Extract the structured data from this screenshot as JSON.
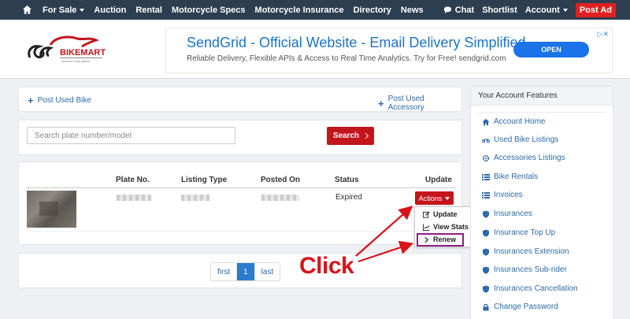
{
  "topnav": {
    "items": [
      "For Sale",
      "Auction",
      "Rental",
      "Motorcycle Specs",
      "Motorcycle Insurance",
      "Directory",
      "News"
    ],
    "right": {
      "chat": "Chat",
      "shortlist": "Shortlist",
      "account": "Account",
      "post_ad": "Post Ad"
    },
    "bg_color": "#2d3e50",
    "accent_color": "#e02020"
  },
  "logo": {
    "text": "BIKEMART",
    "tagline": "WE BUILD YOUR DREAM"
  },
  "ad": {
    "title": "SendGrid - Official Website - Email Delivery Simplified",
    "description": "Reliable Delivery, Flexible APIs & Access to Real Time Analytics. Try for Free! sendgrid.com",
    "button": "OPEN"
  },
  "actions_bar": {
    "post_used_bike": "Post Used Bike",
    "post_used_accessory": "Post Used Accessory"
  },
  "search": {
    "placeholder": "Search plate number/model",
    "button": "Search"
  },
  "table": {
    "headers": {
      "plate": "Plate No.",
      "type": "Listing Type",
      "posted": "Posted On",
      "status": "Status",
      "update": "Update"
    },
    "rows": [
      {
        "status": "Expired",
        "actions": "Actions"
      }
    ]
  },
  "dropdown": {
    "items": [
      "Update",
      "View Stats",
      "Renew"
    ]
  },
  "pagination": {
    "first": "first",
    "current": "1",
    "last": "last"
  },
  "annotation": {
    "label": "Click"
  },
  "sidebar": {
    "title": "Your Account Features",
    "items": [
      "Account Home",
      "Used Bike Listings",
      "Accessories Listings",
      "Bike Rentals",
      "Invoices",
      "Insurances",
      "Insurance Top Up",
      "Insurances Extension",
      "Insurances Sub-rider",
      "Insurances Cancellation",
      "Change Password"
    ]
  }
}
